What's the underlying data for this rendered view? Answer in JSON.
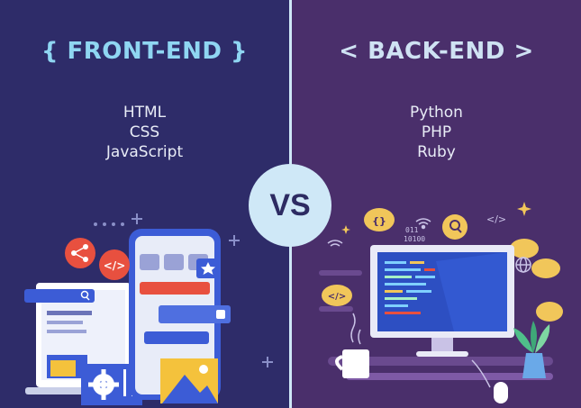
{
  "frontend": {
    "title": "{ FRONT-END }",
    "languages": [
      "HTML",
      "CSS",
      "JavaScript"
    ]
  },
  "backend": {
    "title": "< BACK-END >",
    "languages": [
      "Python",
      "PHP",
      "Ruby"
    ]
  },
  "vs_label": "VS",
  "icons": {
    "code": "</>",
    "binary_top": "011",
    "binary_bottom": "10100"
  },
  "colors": {
    "frontend_bg": "#2e2c69",
    "backend_bg": "#4a2f6b",
    "accent_blue": "#3c5cd6",
    "accent_red": "#e8503f",
    "accent_yellow": "#f4c23c",
    "vs_circle": "#cfe8f7"
  }
}
